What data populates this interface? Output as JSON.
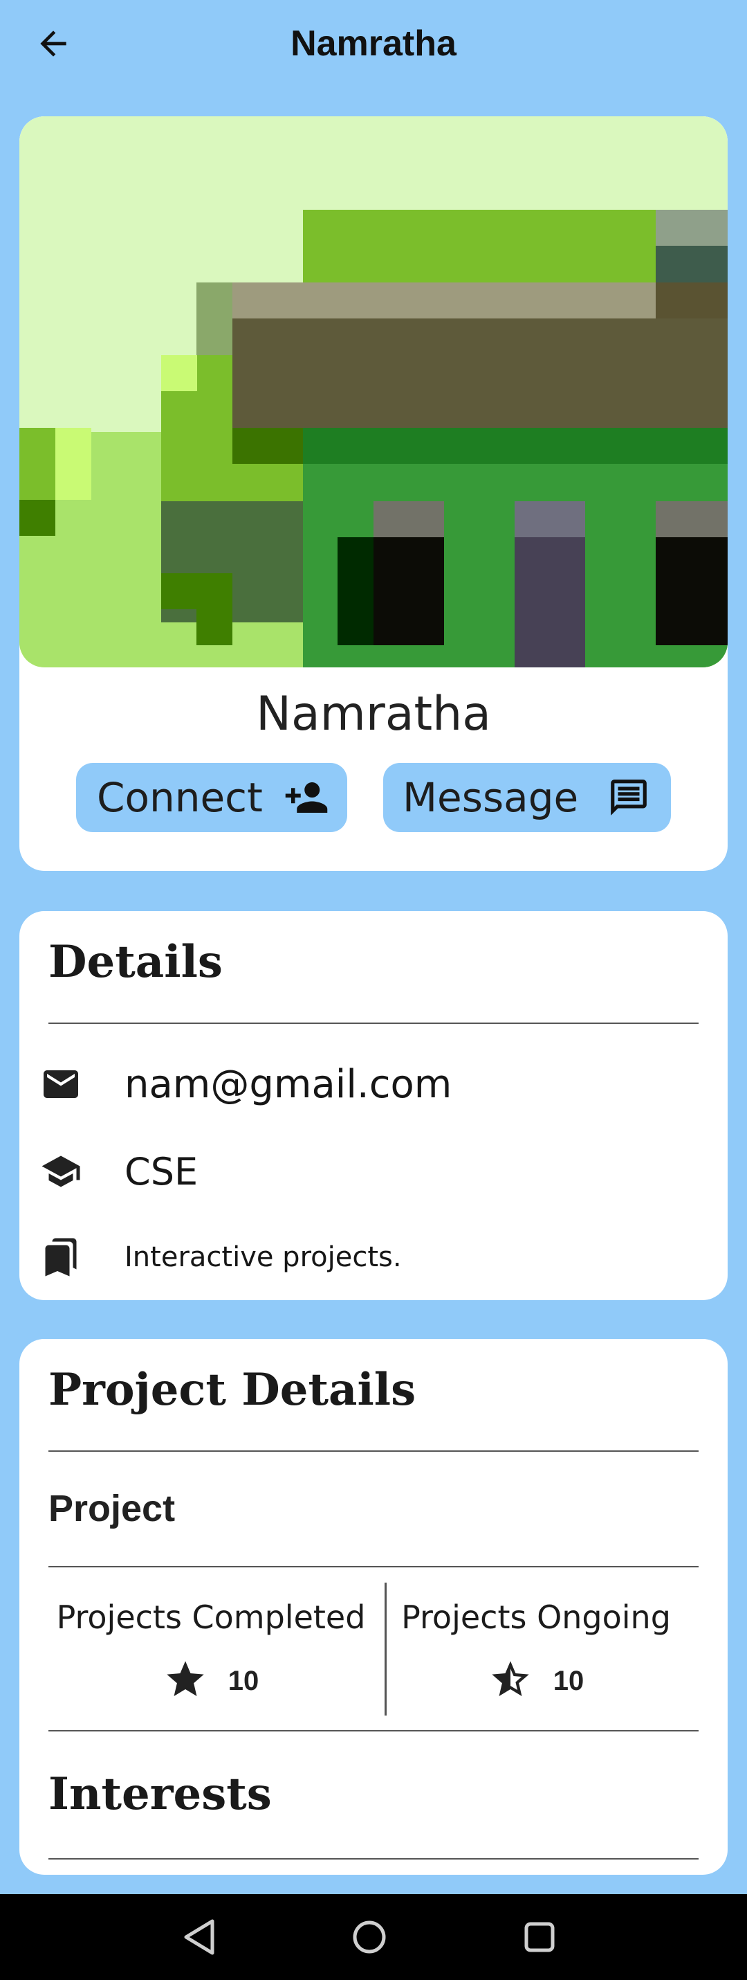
{
  "appbar": {
    "title": "Namratha",
    "back_icon": "arrow-back-icon"
  },
  "profile": {
    "name": "Namratha",
    "cover_image": "pixelated-house-cover-image",
    "connect_label": "Connect",
    "connect_icon": "person-add-icon",
    "message_label": "Message",
    "message_icon": "chat-message-icon"
  },
  "details": {
    "title": "Details",
    "items": [
      {
        "icon": "mail-icon",
        "text": "nam@gmail.com"
      },
      {
        "icon": "school-icon",
        "text": "CSE"
      },
      {
        "icon": "bookmarks-icon",
        "text": "Interactive projects."
      }
    ]
  },
  "project_details": {
    "title": "Project Details",
    "subtitle": "Project",
    "stats": [
      {
        "label": "Projects Completed",
        "value": "10",
        "icon": "star-filled-icon"
      },
      {
        "label": "Projects Ongoing",
        "value": "10",
        "icon": "star-half-icon"
      }
    ],
    "interests_title": "Interests"
  },
  "navbar": {
    "back_icon": "nav-back-triangle-icon",
    "home_icon": "nav-home-circle-icon",
    "recents_icon": "nav-recents-square-icon"
  },
  "colors": {
    "background": "#90CAF9",
    "card": "#FFFFFF",
    "pill": "#90CAF9",
    "navbar": "#000000"
  }
}
